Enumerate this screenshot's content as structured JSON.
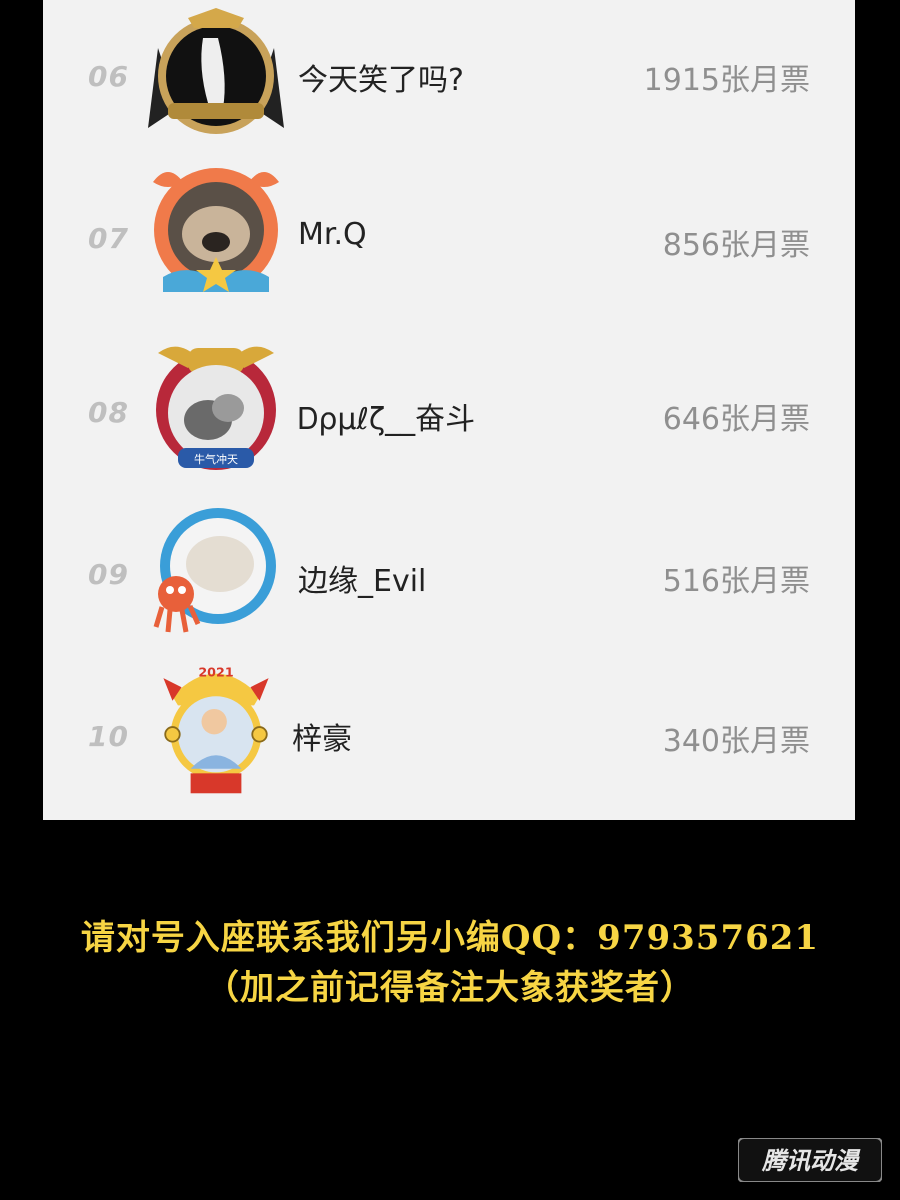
{
  "leaderboard": {
    "rows": [
      {
        "rank": "06",
        "name": "今天笑了吗?",
        "votes": "1915张月票",
        "avatar": "portrait-frame-icon"
      },
      {
        "rank": "07",
        "name": "Mr.Q",
        "votes": "856张月票",
        "avatar": "crab-frame-pug-icon"
      },
      {
        "rank": "08",
        "name": "Ꭰρµℓζ__奋斗",
        "votes": "646张月票",
        "avatar": "ox-frame-cat-icon"
      },
      {
        "rank": "09",
        "name": "边缘_Evil",
        "votes": "516张月票",
        "avatar": "octopus-wave-frame-icon"
      },
      {
        "rank": "10",
        "name": "梓豪",
        "votes": "340张月票",
        "avatar": "ox-2021-frame-child-icon"
      }
    ]
  },
  "notice": {
    "line1": "请对号入座联系我们另小编QQ：979357621",
    "line2": "（加之前记得备注大象获奖者）"
  },
  "watermark": {
    "text": "腾讯动漫"
  },
  "colors": {
    "notice": "#f7d544",
    "background": "#000000",
    "panel": "#f2f2f2"
  }
}
